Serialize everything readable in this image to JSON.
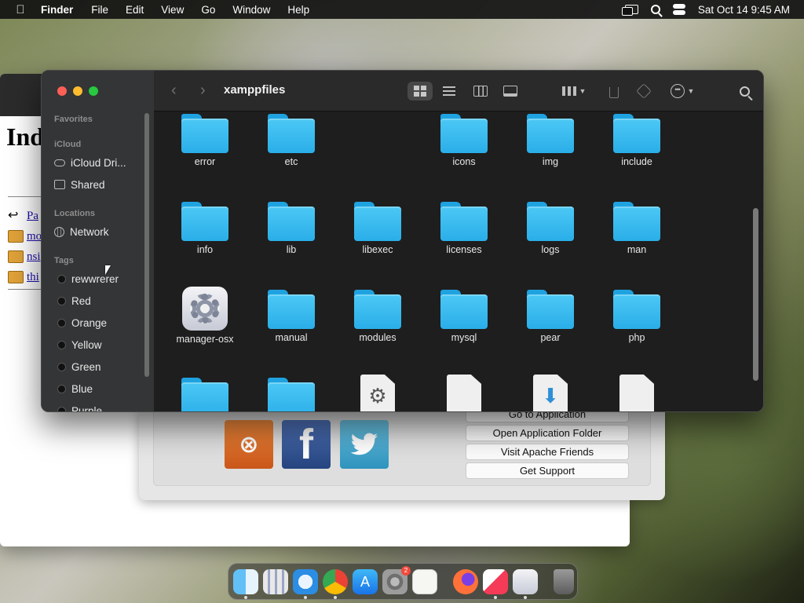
{
  "menubar": {
    "app_name": "Finder",
    "items": [
      "File",
      "Edit",
      "View",
      "Go",
      "Window",
      "Help"
    ],
    "clock": "Sat Oct 14  9:45 AM"
  },
  "browser": {
    "heading": "Ind",
    "links": [
      "Pa",
      "mo",
      "nsi",
      "thi"
    ]
  },
  "xampp": {
    "buttons": [
      "Go to Application",
      "Open Application Folder",
      "Visit Apache Friends",
      "Get Support"
    ]
  },
  "finder": {
    "title": "xamppfiles",
    "sidebar": {
      "favorites_header": "Favorites",
      "icloud_header": "iCloud",
      "icloud_items": [
        "iCloud Dri...",
        "Shared"
      ],
      "locations_header": "Locations",
      "locations_items": [
        "Network"
      ],
      "tags_header": "Tags",
      "tags": [
        "rewwrerer",
        "Red",
        "Orange",
        "Yellow",
        "Green",
        "Blue",
        "Purple"
      ]
    },
    "rows": [
      [
        "error",
        "etc",
        "",
        "icons",
        "img",
        "include"
      ],
      [
        "info",
        "lib",
        "libexec",
        "licenses",
        "logs",
        "man"
      ],
      [
        "manager-osx",
        "manual",
        "modules",
        "mysql",
        "pear",
        "php"
      ]
    ],
    "row4_kinds": [
      "folder",
      "folder",
      "app-doc",
      "doc",
      "installer",
      "doc"
    ]
  },
  "dock": {
    "apps": [
      "finder-icon",
      "launchpad-icon",
      "safari-icon",
      "chrome-icon",
      "app-store-icon",
      "system-settings-icon",
      "textedit-icon",
      "firefox-icon",
      "news-icon",
      "manager-osx-icon",
      "trash-icon"
    ],
    "badge": "2"
  },
  "colors": {
    "folder": "#3ab9ee",
    "finder_bg": "#1e1e1e",
    "sidebar_bg": "#333536"
  }
}
